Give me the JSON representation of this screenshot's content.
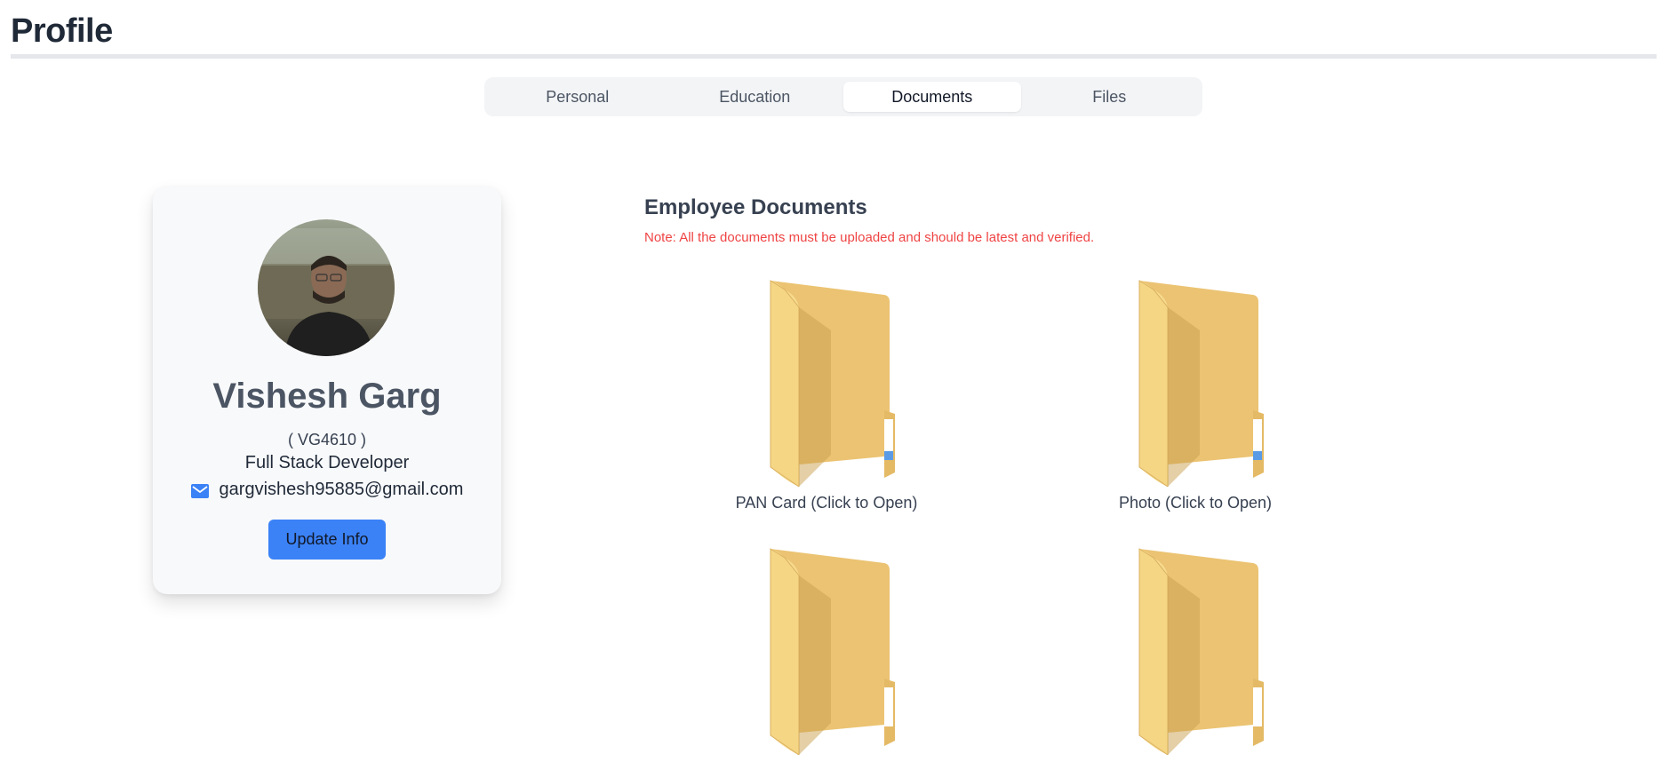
{
  "header": {
    "title": "Profile"
  },
  "tabs": [
    {
      "label": "Personal",
      "active": false
    },
    {
      "label": "Education",
      "active": false
    },
    {
      "label": "Documents",
      "active": true
    },
    {
      "label": "Files",
      "active": false
    }
  ],
  "profile": {
    "name": "Vishesh Garg",
    "employee_id": "( VG4610 )",
    "role": "Full Stack Developer",
    "email": "gargvishesh95885@gmail.com",
    "update_label": "Update Info"
  },
  "documents": {
    "heading": "Employee Documents",
    "note": "Note: All the documents must be uploaded and should be latest and verified.",
    "items": [
      {
        "label": "PAN Card (Click to Open)"
      },
      {
        "label": "Photo (Click to Open)"
      },
      {
        "label": ""
      },
      {
        "label": ""
      }
    ]
  },
  "colors": {
    "accent": "#3b82f6",
    "note": "#ef4444",
    "folder": "#f2cd7c"
  },
  "icons": [
    "mail-icon",
    "folder-icon"
  ]
}
